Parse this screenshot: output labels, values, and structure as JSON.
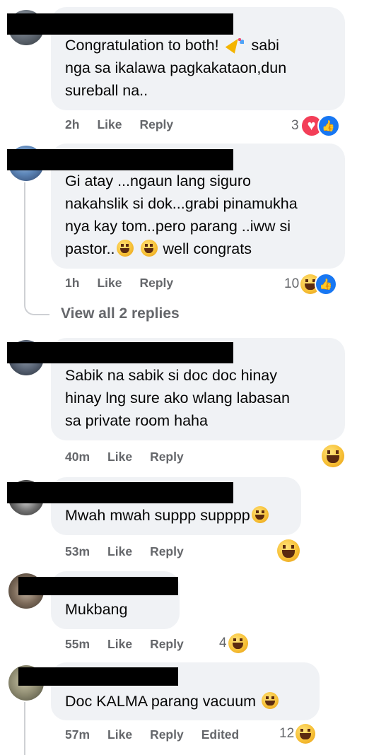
{
  "comments": [
    {
      "text_before": "Congratulation to both! ",
      "text_after": " sabi\nnga sa ikalawa pagkakataon,dun\nsureball na..",
      "time": "2h",
      "like_label": "Like",
      "reply_label": "Reply",
      "reaction_count": "3",
      "reactions": [
        "heart-icon",
        "like-icon"
      ]
    },
    {
      "text": "Gi atay ...ngaun lang siguro\nnakahslik si dok...grabi pinamukha\nnya kay tom..pero parang ..iww si\npastor..",
      "text_tail": " well congrats",
      "time": "1h",
      "like_label": "Like",
      "reply_label": "Reply",
      "reaction_count": "10",
      "reactions": [
        "haha-icon",
        "like-icon"
      ],
      "view_replies": "View all 2 replies"
    },
    {
      "text": "Sabik na sabik si doc doc hinay\nhinay lng sure ako wlang labasan\nsa private room haha",
      "time": "40m",
      "like_label": "Like",
      "reply_label": "Reply",
      "reactions": [
        "haha-icon"
      ]
    },
    {
      "text": "Mwah mwah suppp supppp",
      "time": "53m",
      "like_label": "Like",
      "reply_label": "Reply",
      "reactions": [
        "haha-icon"
      ]
    },
    {
      "text": "Mukbang",
      "time": "55m",
      "like_label": "Like",
      "reply_label": "Reply",
      "reaction_count": "4",
      "reactions": [
        "haha-icon"
      ]
    },
    {
      "text": "Doc KALMA parang vacuum ",
      "time": "57m",
      "like_label": "Like",
      "reply_label": "Reply",
      "edited_label": "Edited",
      "reaction_count": "12",
      "reactions": [
        "haha-icon"
      ]
    }
  ],
  "colors": {
    "bubble": "#f0f2f5",
    "meta_text": "#65676b",
    "like_blue": "#1877f2",
    "love_red": "#f33e58"
  }
}
